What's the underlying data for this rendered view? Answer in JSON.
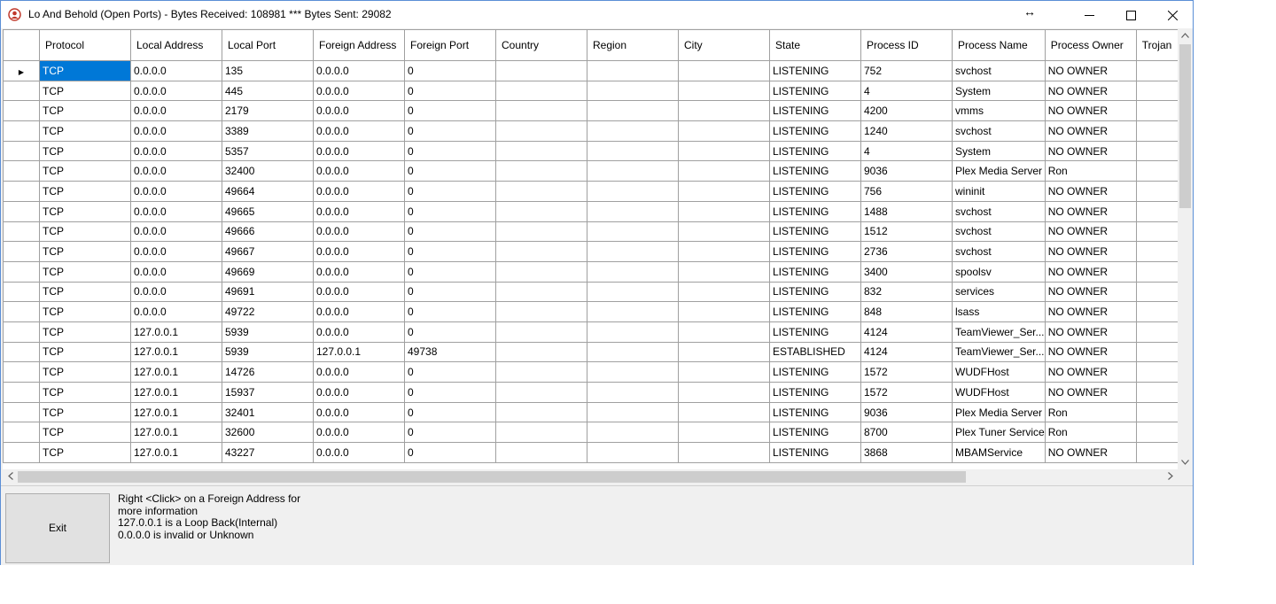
{
  "window": {
    "title": "Lo And Behold (Open Ports) - Bytes Received: 108981 *** Bytes Sent: 29082",
    "resize_glyph": "↔",
    "minimize_glyph": "—",
    "maximize_glyph": "☐",
    "close_glyph": "✕"
  },
  "grid": {
    "columns": [
      {
        "key": "protocol",
        "label": "Protocol",
        "width": 103
      },
      {
        "key": "local_address",
        "label": "Local Address",
        "width": 103
      },
      {
        "key": "local_port",
        "label": "Local Port",
        "width": 103
      },
      {
        "key": "foreign_address",
        "label": "Foreign Address",
        "width": 103
      },
      {
        "key": "foreign_port",
        "label": "Foreign Port",
        "width": 103
      },
      {
        "key": "country",
        "label": "Country",
        "width": 103
      },
      {
        "key": "region",
        "label": "Region",
        "width": 103
      },
      {
        "key": "city",
        "label": "City",
        "width": 103
      },
      {
        "key": "state",
        "label": "State",
        "width": 103
      },
      {
        "key": "process_id",
        "label": "Process ID",
        "width": 103
      },
      {
        "key": "process_name",
        "label": "Process Name",
        "width": 103
      },
      {
        "key": "process_owner",
        "label": "Process Owner",
        "width": 103
      },
      {
        "key": "trojan",
        "label": "Trojan",
        "width": 60
      }
    ],
    "rows": [
      [
        "TCP",
        "0.0.0.0",
        "135",
        "0.0.0.0",
        "0",
        "",
        "",
        "",
        "LISTENING",
        "752",
        "svchost",
        "NO OWNER",
        ""
      ],
      [
        "TCP",
        "0.0.0.0",
        "445",
        "0.0.0.0",
        "0",
        "",
        "",
        "",
        "LISTENING",
        "4",
        "System",
        "NO OWNER",
        ""
      ],
      [
        "TCP",
        "0.0.0.0",
        "2179",
        "0.0.0.0",
        "0",
        "",
        "",
        "",
        "LISTENING",
        "4200",
        "vmms",
        "NO OWNER",
        ""
      ],
      [
        "TCP",
        "0.0.0.0",
        "3389",
        "0.0.0.0",
        "0",
        "",
        "",
        "",
        "LISTENING",
        "1240",
        "svchost",
        "NO OWNER",
        ""
      ],
      [
        "TCP",
        "0.0.0.0",
        "5357",
        "0.0.0.0",
        "0",
        "",
        "",
        "",
        "LISTENING",
        "4",
        "System",
        "NO OWNER",
        ""
      ],
      [
        "TCP",
        "0.0.0.0",
        "32400",
        "0.0.0.0",
        "0",
        "",
        "",
        "",
        "LISTENING",
        "9036",
        "Plex Media Server",
        "Ron",
        ""
      ],
      [
        "TCP",
        "0.0.0.0",
        "49664",
        "0.0.0.0",
        "0",
        "",
        "",
        "",
        "LISTENING",
        "756",
        "wininit",
        "NO OWNER",
        ""
      ],
      [
        "TCP",
        "0.0.0.0",
        "49665",
        "0.0.0.0",
        "0",
        "",
        "",
        "",
        "LISTENING",
        "1488",
        "svchost",
        "NO OWNER",
        ""
      ],
      [
        "TCP",
        "0.0.0.0",
        "49666",
        "0.0.0.0",
        "0",
        "",
        "",
        "",
        "LISTENING",
        "1512",
        "svchost",
        "NO OWNER",
        ""
      ],
      [
        "TCP",
        "0.0.0.0",
        "49667",
        "0.0.0.0",
        "0",
        "",
        "",
        "",
        "LISTENING",
        "2736",
        "svchost",
        "NO OWNER",
        ""
      ],
      [
        "TCP",
        "0.0.0.0",
        "49669",
        "0.0.0.0",
        "0",
        "",
        "",
        "",
        "LISTENING",
        "3400",
        "spoolsv",
        "NO OWNER",
        ""
      ],
      [
        "TCP",
        "0.0.0.0",
        "49691",
        "0.0.0.0",
        "0",
        "",
        "",
        "",
        "LISTENING",
        "832",
        "services",
        "NO OWNER",
        ""
      ],
      [
        "TCP",
        "0.0.0.0",
        "49722",
        "0.0.0.0",
        "0",
        "",
        "",
        "",
        "LISTENING",
        "848",
        "lsass",
        "NO OWNER",
        ""
      ],
      [
        "TCP",
        "127.0.0.1",
        "5939",
        "0.0.0.0",
        "0",
        "",
        "",
        "",
        "LISTENING",
        "4124",
        "TeamViewer_Ser...",
        "NO OWNER",
        ""
      ],
      [
        "TCP",
        "127.0.0.1",
        "5939",
        "127.0.0.1",
        "49738",
        "",
        "",
        "",
        "ESTABLISHED",
        "4124",
        "TeamViewer_Ser...",
        "NO OWNER",
        ""
      ],
      [
        "TCP",
        "127.0.0.1",
        "14726",
        "0.0.0.0",
        "0",
        "",
        "",
        "",
        "LISTENING",
        "1572",
        "WUDFHost",
        "NO OWNER",
        ""
      ],
      [
        "TCP",
        "127.0.0.1",
        "15937",
        "0.0.0.0",
        "0",
        "",
        "",
        "",
        "LISTENING",
        "1572",
        "WUDFHost",
        "NO OWNER",
        ""
      ],
      [
        "TCP",
        "127.0.0.1",
        "32401",
        "0.0.0.0",
        "0",
        "",
        "",
        "",
        "LISTENING",
        "9036",
        "Plex Media Server",
        "Ron",
        ""
      ],
      [
        "TCP",
        "127.0.0.1",
        "32600",
        "0.0.0.0",
        "0",
        "",
        "",
        "",
        "LISTENING",
        "8700",
        "Plex Tuner Service",
        "Ron",
        ""
      ],
      [
        "TCP",
        "127.0.0.1",
        "43227",
        "0.0.0.0",
        "0",
        "",
        "",
        "",
        "LISTENING",
        "3868",
        "MBAMService",
        "NO OWNER",
        ""
      ]
    ],
    "current_row_marker": "▶",
    "selected_row": 0,
    "selected_col": 0
  },
  "scrollbars": {
    "up": "▲",
    "down": "▼",
    "left": "◀",
    "right": "▶"
  },
  "footer": {
    "exit_label": "Exit",
    "info_lines": [
      "Right <Click> on a Foreign Address for more information",
      "127.0.0.1 is a Loop Back(Internal)",
      "0.0.0.0 is invalid or Unknown"
    ]
  },
  "colors": {
    "selection": "#0078d7",
    "grid_line": "#a0a0a0"
  }
}
